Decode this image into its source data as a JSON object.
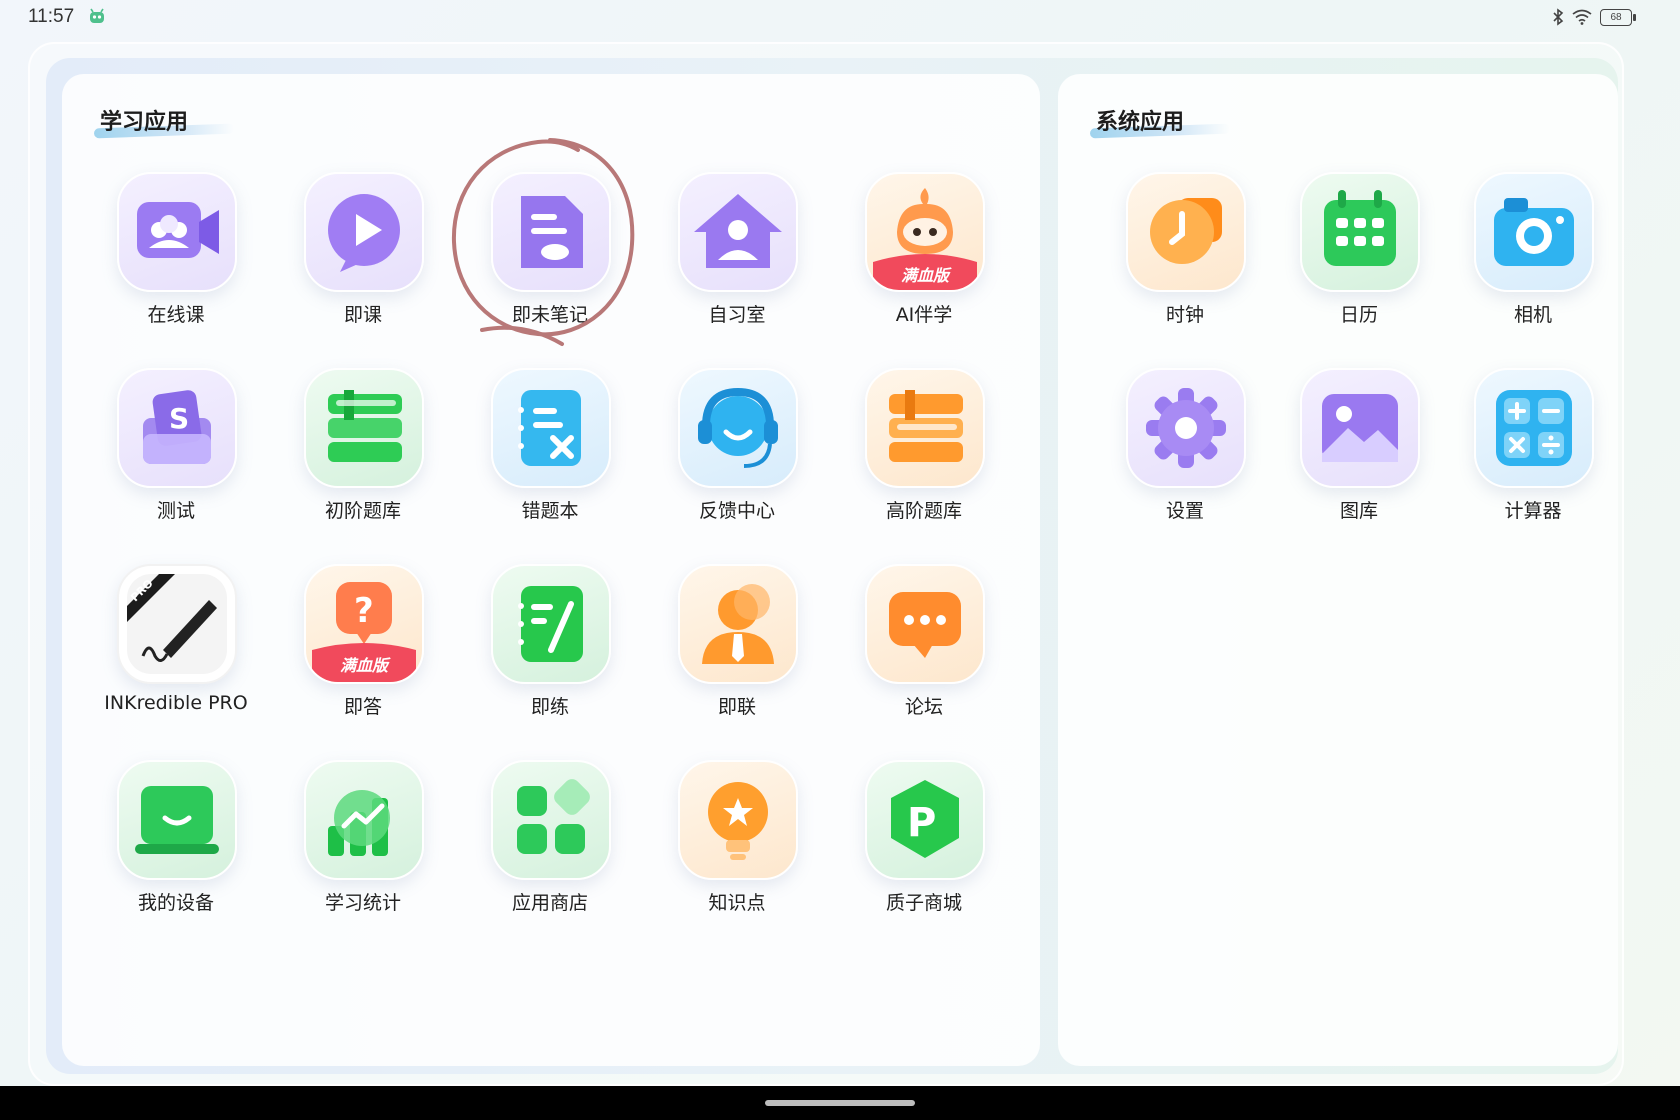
{
  "status_bar": {
    "time": "11:57",
    "battery": "68"
  },
  "learning_apps": {
    "title": "学习应用",
    "apps": [
      {
        "label": "在线课"
      },
      {
        "label": "即课"
      },
      {
        "label": "即未笔记"
      },
      {
        "label": "自习室"
      },
      {
        "label": "AI伴学",
        "badge": "满血版"
      },
      {
        "label": "测试"
      },
      {
        "label": "初阶题库"
      },
      {
        "label": "错题本"
      },
      {
        "label": "反馈中心"
      },
      {
        "label": "高阶题库"
      },
      {
        "label": "INKredible PRO",
        "badge": "PRO"
      },
      {
        "label": "即答",
        "badge": "满血版"
      },
      {
        "label": "即练"
      },
      {
        "label": "即联"
      },
      {
        "label": "论坛"
      },
      {
        "label": "我的设备"
      },
      {
        "label": "学习统计"
      },
      {
        "label": "应用商店"
      },
      {
        "label": "知识点"
      },
      {
        "label": "质子商城"
      }
    ]
  },
  "system_apps": {
    "title": "系统应用",
    "apps": [
      {
        "label": "时钟"
      },
      {
        "label": "日历"
      },
      {
        "label": "相机"
      },
      {
        "label": "设置"
      },
      {
        "label": "图库"
      },
      {
        "label": "计算器"
      }
    ]
  }
}
